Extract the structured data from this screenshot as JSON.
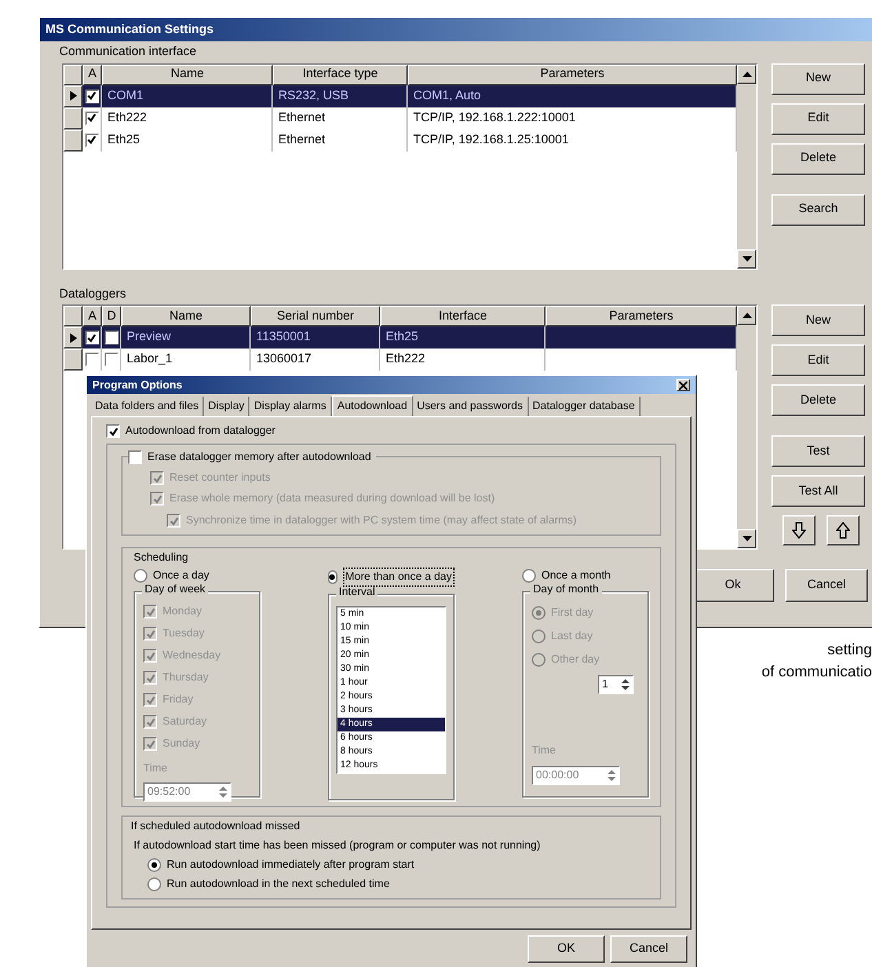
{
  "main_window": {
    "title": "MS Communication Settings",
    "interfaces": {
      "label": "Communication interface",
      "columns": [
        "A",
        "Name",
        "Interface type",
        "Parameters"
      ],
      "rows": [
        {
          "active": true,
          "selected": true,
          "cells": [
            "COM1",
            "RS232, USB",
            "COM1, Auto"
          ]
        },
        {
          "active": true,
          "selected": false,
          "cells": [
            "Eth222",
            "Ethernet",
            "TCP/IP, 192.168.1.222:10001"
          ]
        },
        {
          "active": true,
          "selected": false,
          "cells": [
            "Eth25",
            "Ethernet",
            "TCP/IP, 192.168.1.25:10001"
          ]
        }
      ],
      "buttons": [
        "New",
        "Edit",
        "Delete",
        "Search"
      ]
    },
    "dataloggers": {
      "label": "Dataloggers",
      "columns": [
        "A",
        "D",
        "Name",
        "Serial number",
        "Interface",
        "Parameters"
      ],
      "rows": [
        {
          "active": true,
          "download": false,
          "selected": true,
          "cells": [
            "Preview",
            "11350001",
            "Eth25",
            ""
          ]
        },
        {
          "active": false,
          "download": false,
          "selected": false,
          "cells": [
            "Labor_1",
            "13060017",
            "Eth222",
            ""
          ]
        }
      ],
      "buttons": [
        "New",
        "Edit",
        "Delete",
        "Test",
        "Test All"
      ]
    },
    "buttons": [
      "Ok",
      "Cancel"
    ]
  },
  "dialog": {
    "title": "Program Options",
    "tabs": [
      {
        "label": "Data folders and files",
        "selected": false
      },
      {
        "label": "Display",
        "selected": false
      },
      {
        "label": "Display alarms",
        "selected": false
      },
      {
        "label": "Autodownload",
        "selected": true
      },
      {
        "label": "Users and passwords",
        "selected": false
      },
      {
        "label": "Datalogger database",
        "selected": false
      }
    ],
    "autodownload": {
      "label": "Autodownload from datalogger",
      "checked": true
    },
    "erase": {
      "label": "Erase datalogger memory after autodownload",
      "checked": false
    },
    "erase_options": [
      {
        "label": "Reset counter inputs",
        "checked": true,
        "disabled": true
      },
      {
        "label": "Erase whole memory (data measured during download will be lost)",
        "checked": true,
        "disabled": true,
        "children": [
          {
            "label": "Synchronize time in datalogger with PC system time (may affect state of alarms)",
            "checked": true,
            "disabled": true
          }
        ]
      }
    ],
    "scheduling": {
      "label": "Scheduling",
      "modes": [
        {
          "label": "Once a day",
          "selected": false
        },
        {
          "label": "More than once a day",
          "selected": true
        },
        {
          "label": "Once a month",
          "selected": false
        }
      ],
      "day_of_week": {
        "label": "Day of week",
        "days": [
          {
            "label": "Monday",
            "checked": true
          },
          {
            "label": "Tuesday",
            "checked": true
          },
          {
            "label": "Wednesday",
            "checked": true
          },
          {
            "label": "Thursday",
            "checked": true
          },
          {
            "label": "Friday",
            "checked": true
          },
          {
            "label": "Saturday",
            "checked": true
          },
          {
            "label": "Sunday",
            "checked": true
          }
        ],
        "time_label": "Time",
        "time": "09:52:00"
      },
      "interval": {
        "label": "Interval",
        "options": [
          {
            "label": "5 min",
            "selected": false
          },
          {
            "label": "10 min",
            "selected": false
          },
          {
            "label": "15 min",
            "selected": false
          },
          {
            "label": "20 min",
            "selected": false
          },
          {
            "label": "30 min",
            "selected": false
          },
          {
            "label": "1 hour",
            "selected": false
          },
          {
            "label": "2 hours",
            "selected": false
          },
          {
            "label": "3 hours",
            "selected": false
          },
          {
            "label": "4 hours",
            "selected": true
          },
          {
            "label": "6 hours",
            "selected": false
          },
          {
            "label": "8 hours",
            "selected": false
          },
          {
            "label": "12 hours",
            "selected": false
          }
        ]
      },
      "day_of_month": {
        "label": "Day of month",
        "options": [
          {
            "label": "First day",
            "selected": true
          },
          {
            "label": "Last day",
            "selected": false
          },
          {
            "label": "Other day",
            "selected": false
          }
        ],
        "day": "1",
        "time_label": "Time",
        "time": "00:00:00"
      }
    },
    "missed": {
      "label": "If scheduled autodownload missed",
      "text": "If autodownload start time has been missed (program or computer was not running)",
      "options": [
        {
          "label": "Run autodownload immediately after program start",
          "selected": true
        },
        {
          "label": "Run autodownload in the next scheduled time",
          "selected": false
        }
      ]
    },
    "buttons": [
      "OK",
      "Cancel"
    ]
  },
  "caption": [
    "setting",
    "of communicatio"
  ]
}
